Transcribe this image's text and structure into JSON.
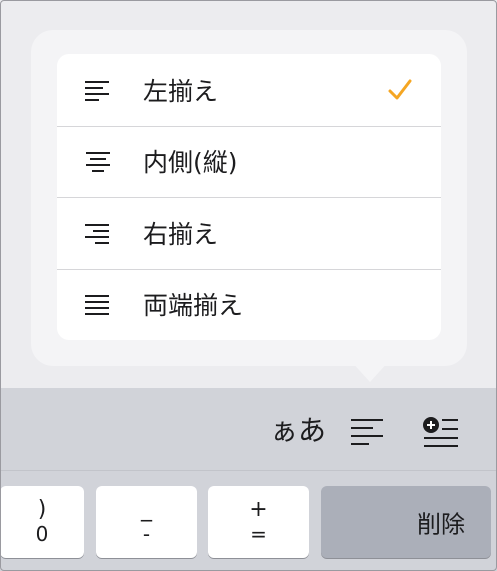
{
  "alignment_menu": {
    "items": [
      {
        "label": "左揃え",
        "icon": "align-left-icon",
        "selected": true
      },
      {
        "label": "内側(縦)",
        "icon": "align-center-icon",
        "selected": false
      },
      {
        "label": "右揃え",
        "icon": "align-right-icon",
        "selected": false
      },
      {
        "label": "両端揃え",
        "icon": "align-justify-icon",
        "selected": false
      }
    ],
    "check_color": "#f5a623"
  },
  "toolbar": {
    "input_mode_label": "ぁあ",
    "align_icon": "align-left-icon",
    "insert_icon": "insert-plus-list-icon"
  },
  "keyboard": {
    "keys": [
      {
        "top": ")",
        "bottom": "0"
      },
      {
        "top": "_",
        "bottom": "-"
      },
      {
        "top": "+",
        "bottom": "="
      }
    ],
    "delete_label": "削除"
  }
}
